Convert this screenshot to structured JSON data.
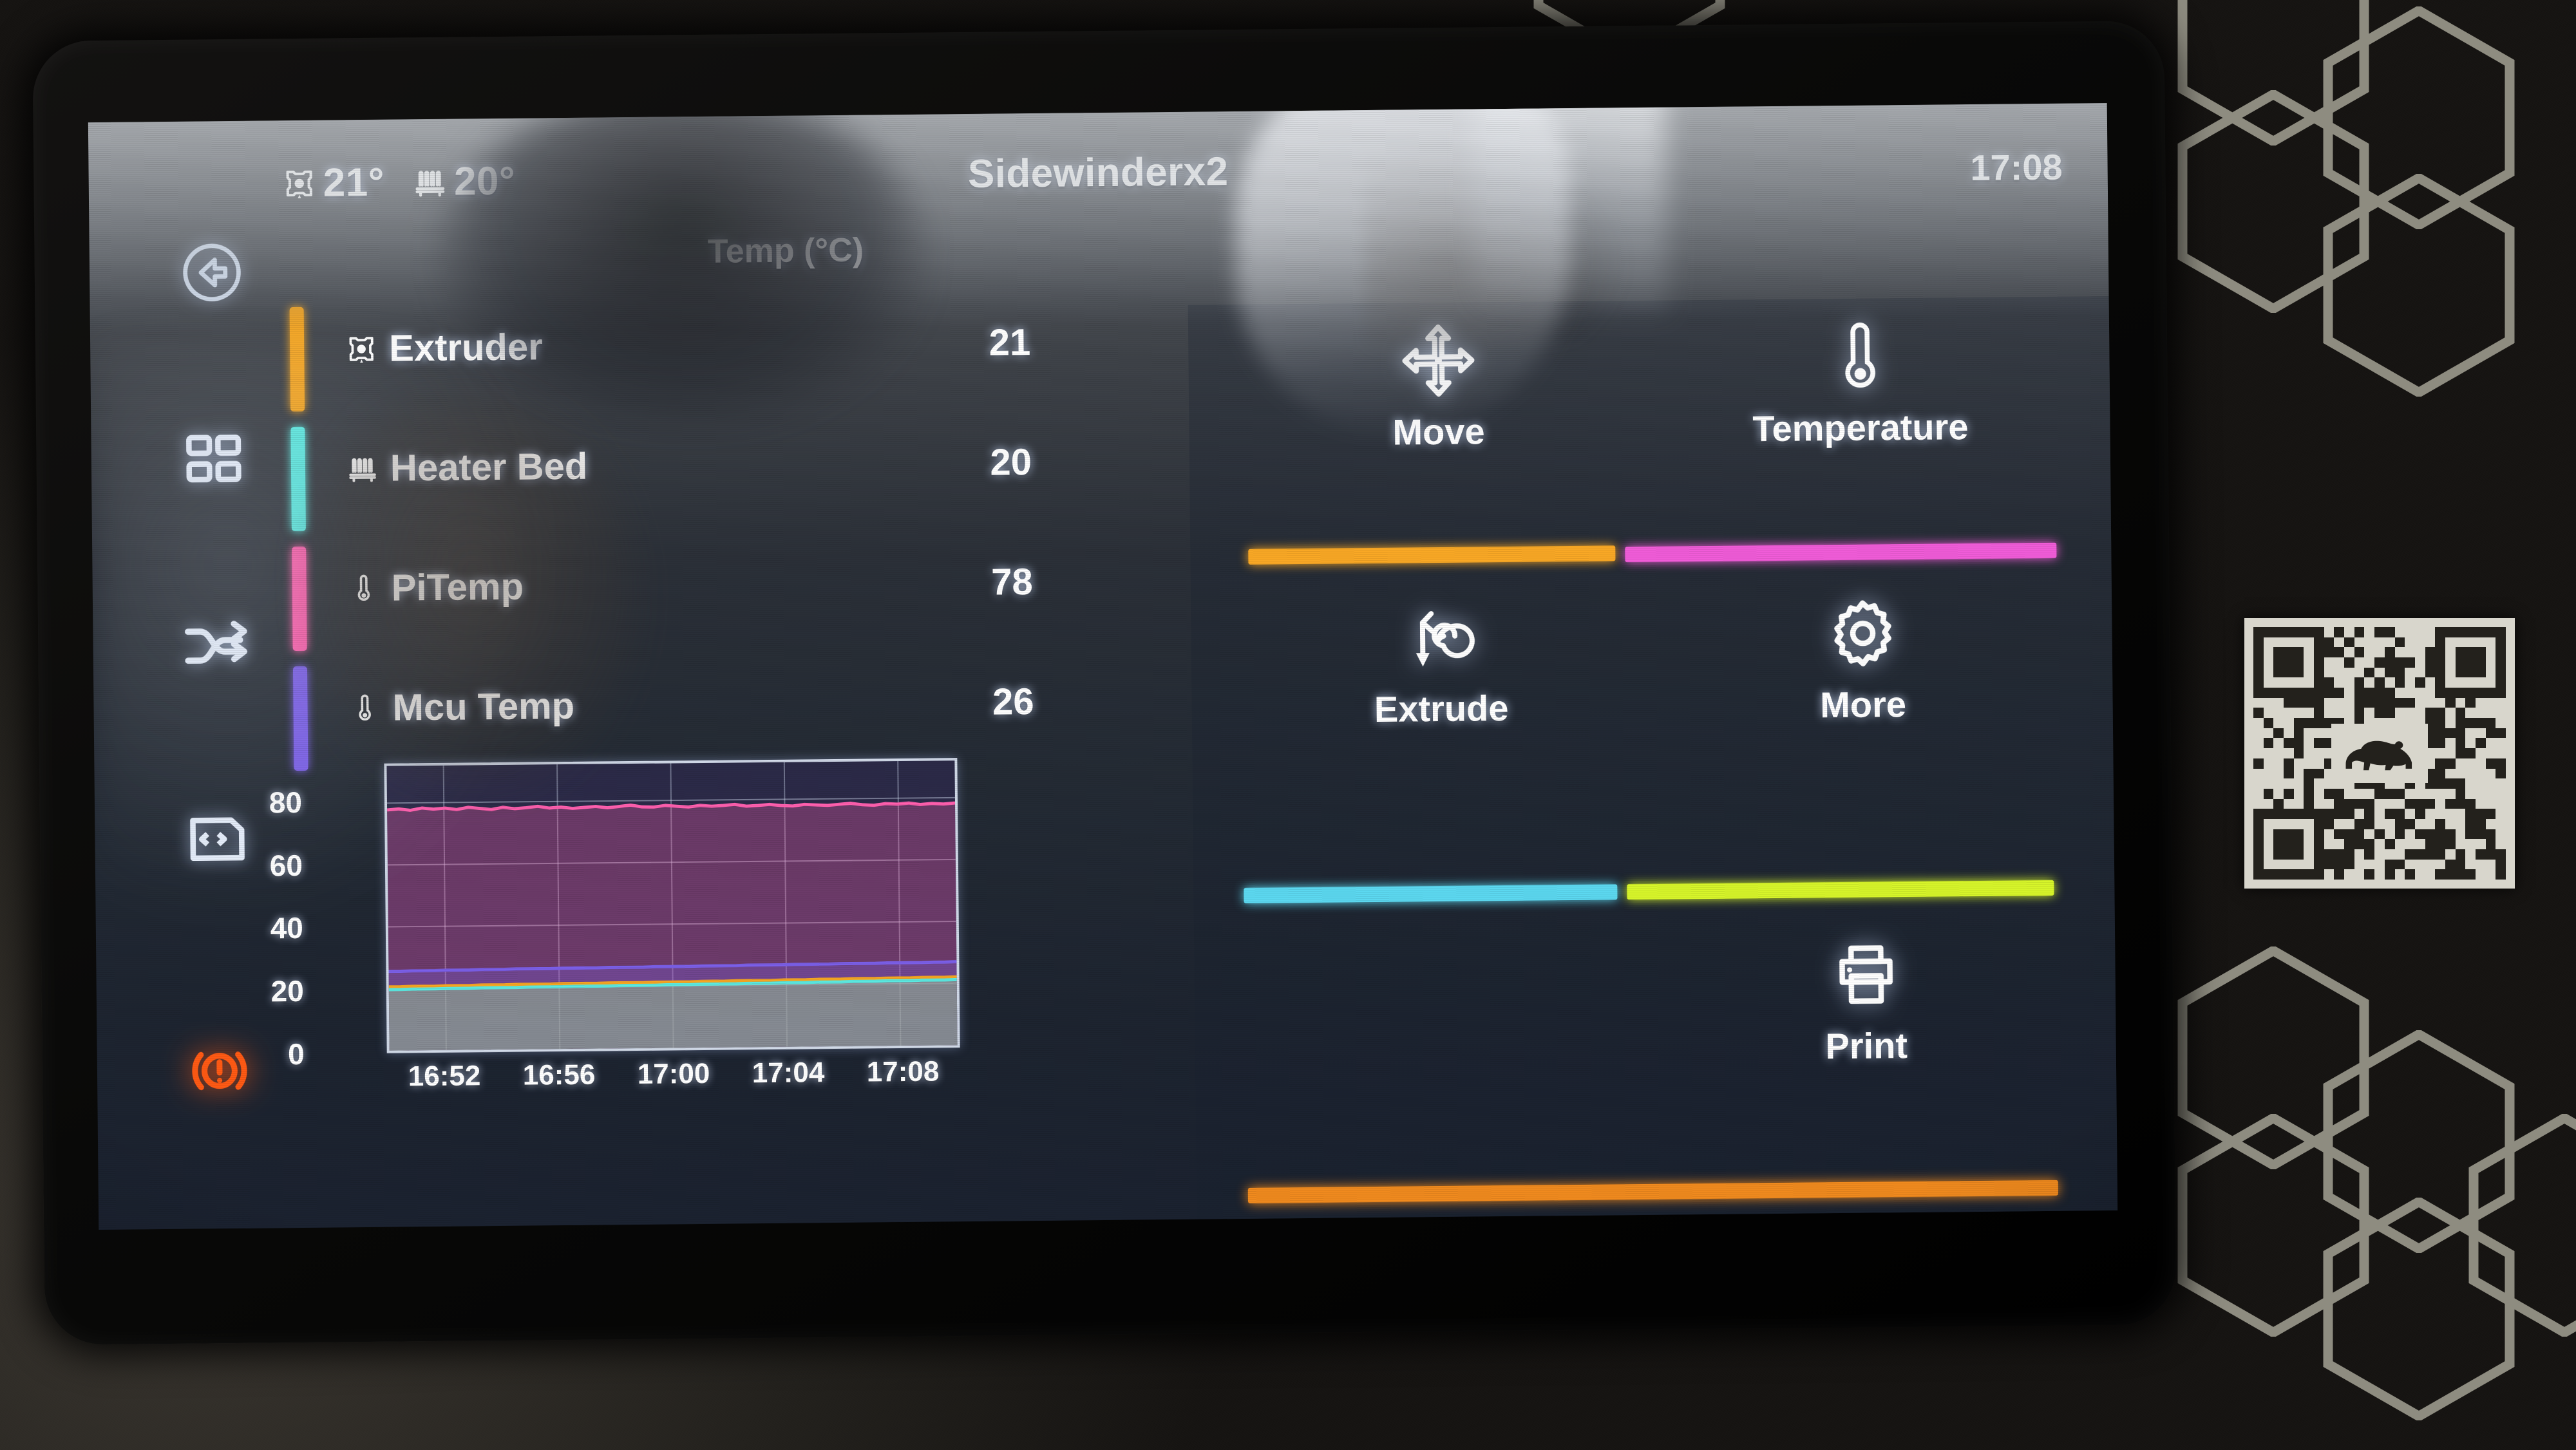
{
  "header": {
    "title": "Sidewinderx2",
    "clock": "17:08",
    "status": [
      {
        "icon": "extruder-nozzle-icon",
        "value": "21°"
      },
      {
        "icon": "heater-bed-icon",
        "value": "20°"
      }
    ]
  },
  "sidebar": {
    "items": [
      {
        "name": "back-button",
        "icon": "back-arrow-circle-icon"
      },
      {
        "name": "dashboard-button",
        "icon": "grid-squares-icon"
      },
      {
        "name": "network-button",
        "icon": "shuffle-icon"
      },
      {
        "name": "console-button",
        "icon": "console-script-icon"
      },
      {
        "name": "emergency-stop-button",
        "icon": "emergency-stop-icon",
        "color": "#FF5A14"
      }
    ]
  },
  "temperature_panel": {
    "column_header": "Temp (°C)",
    "rows": [
      {
        "label": "Extruder",
        "icon": "extruder-nozzle-icon",
        "value": "21",
        "color": "#F5A623"
      },
      {
        "label": "Heater Bed",
        "icon": "heater-bed-icon",
        "value": "20",
        "color": "#5CE8E0"
      },
      {
        "label": "PiTemp",
        "icon": "thermometer-icon",
        "value": "78",
        "color": "#FF5FAE"
      },
      {
        "label": "Mcu Temp",
        "icon": "thermometer-icon",
        "value": "26",
        "color": "#7B5FE8"
      }
    ]
  },
  "chart_data": {
    "type": "line",
    "title": "",
    "xlabel": "",
    "ylabel": "Temp (°C)",
    "ylim": [
      0,
      92
    ],
    "yticks": [
      0,
      20,
      40,
      60,
      80
    ],
    "xticks": [
      "16:52",
      "16:56",
      "17:00",
      "17:04",
      "17:08"
    ],
    "grid": true,
    "legend": "none",
    "series": [
      {
        "name": "PiTemp",
        "color": "#FF5FAE",
        "value": 78,
        "values": [
          77.8,
          78.1,
          77.6,
          78.3,
          77.9,
          78.2,
          77.7,
          78.4,
          78.0,
          77.6,
          78.3,
          77.8,
          78.1,
          78.5,
          77.9,
          78.2,
          77.7,
          78.0,
          78.3,
          77.8,
          78.2,
          78.6,
          78.0,
          77.9,
          78.4,
          78.1,
          77.8,
          78.3,
          78.0,
          78.2,
          78.5,
          77.9,
          78.1,
          78.4,
          78.0,
          77.8,
          78.3,
          78.1,
          77.9,
          78.2,
          78.5,
          78.0,
          77.8,
          78.3,
          78.1,
          78.4,
          77.9,
          78.2,
          78.0,
          78.3
        ]
      },
      {
        "name": "Mcu Temp",
        "color": "#7B5FE8",
        "value": 26,
        "values": [
          25.6,
          25.6,
          25.7,
          25.7,
          25.7,
          25.8,
          25.8,
          25.8,
          25.9,
          25.9,
          25.9,
          26.0,
          26.0,
          26.0,
          26.0,
          26.1,
          26.1,
          26.1,
          26.1,
          26.2,
          26.2,
          26.2,
          26.2,
          26.3,
          26.3,
          26.3,
          26.3,
          26.4,
          26.4,
          26.4,
          26.4,
          26.5,
          26.5,
          26.5,
          26.5,
          26.6,
          26.6,
          26.6,
          26.6,
          26.7,
          26.7,
          26.7,
          26.7,
          26.8,
          26.8,
          26.8,
          26.8,
          26.9,
          26.9,
          27.0
        ]
      },
      {
        "name": "Extruder",
        "color": "#F5A623",
        "value": 21,
        "values": [
          20.6,
          20.6,
          20.7,
          20.7,
          20.7,
          20.8,
          20.8,
          20.8,
          20.9,
          20.9,
          20.9,
          21.0,
          21.0,
          21.0,
          21.0,
          21.1,
          21.1,
          21.1,
          21.1,
          21.2,
          21.2,
          21.2,
          21.2,
          21.3,
          21.3,
          21.3,
          21.3,
          21.4,
          21.4,
          21.4,
          21.5,
          21.5,
          21.5,
          21.5,
          21.6,
          21.6,
          21.6,
          21.7,
          21.7,
          21.7,
          21.8,
          21.8,
          21.8,
          21.9,
          21.9,
          21.9,
          22.0,
          22.0,
          22.0,
          22.1
        ]
      },
      {
        "name": "Heater Bed",
        "color": "#5CE8E0",
        "value": 20,
        "values": [
          19.7,
          19.7,
          19.8,
          19.8,
          19.8,
          19.9,
          19.9,
          19.9,
          20.0,
          20.0,
          20.0,
          20.0,
          20.1,
          20.1,
          20.1,
          20.1,
          20.2,
          20.2,
          20.2,
          20.2,
          20.3,
          20.3,
          20.3,
          20.3,
          20.4,
          20.4,
          20.4,
          20.5,
          20.5,
          20.5,
          20.5,
          20.6,
          20.6,
          20.6,
          20.7,
          20.7,
          20.7,
          20.8,
          20.8,
          20.8,
          20.9,
          20.9,
          20.9,
          21.0,
          21.0,
          21.0,
          21.1,
          21.1,
          21.1,
          21.2
        ]
      }
    ]
  },
  "actions": [
    {
      "label": "Move",
      "icon": "move-arrows-icon"
    },
    {
      "label": "Temperature",
      "icon": "thermometer-icon"
    },
    {
      "label": "Extrude",
      "icon": "extrude-spiral-icon"
    },
    {
      "label": "More",
      "icon": "gear-icon"
    },
    {
      "label": "Print",
      "icon": "printer-icon"
    }
  ],
  "divider_bars": [
    {
      "color": "#F9A825"
    },
    {
      "color": "#F05CD8"
    },
    {
      "color": "#5CD8F0"
    },
    {
      "color": "#D7F52A"
    },
    {
      "color": "#F08A1E"
    }
  ]
}
